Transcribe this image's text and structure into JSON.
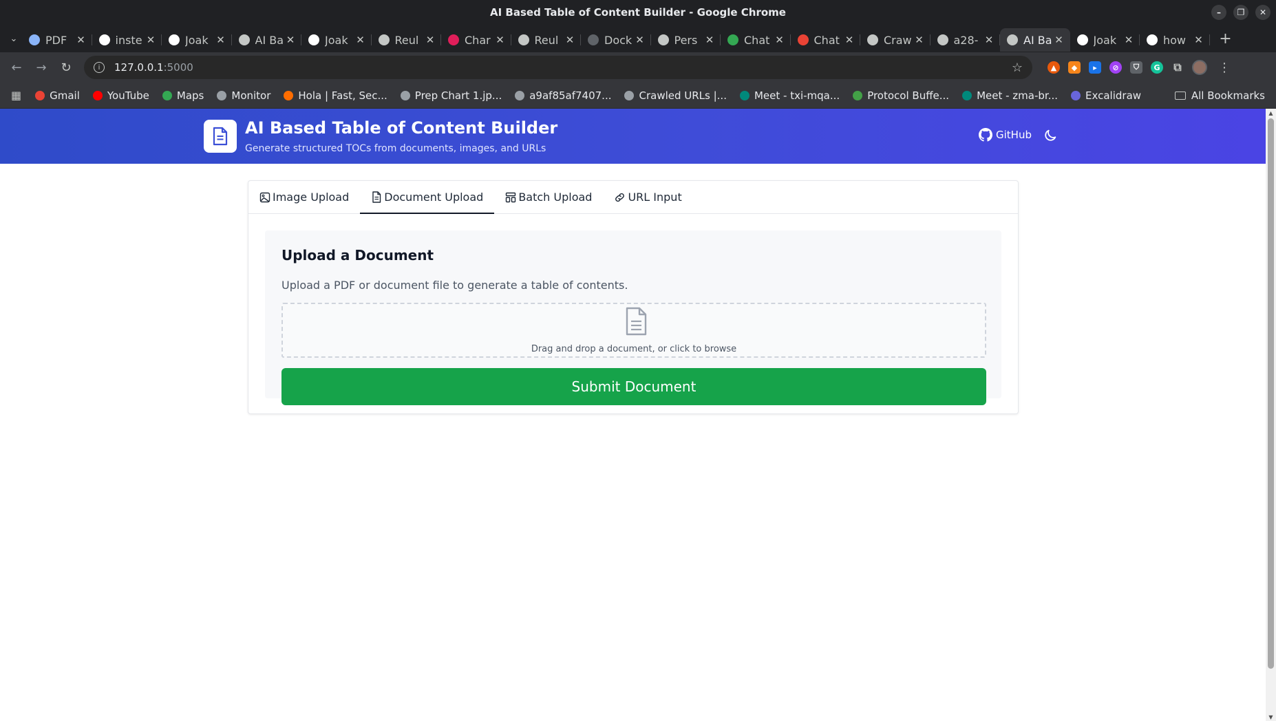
{
  "window": {
    "title": "AI Based Table of Content Builder - Google Chrome"
  },
  "tabs": [
    {
      "title": "PDF",
      "icon": "gear-icon",
      "color": "#8ab4f8"
    },
    {
      "title": "inste",
      "icon": "google-icon",
      "color": "#ffffff"
    },
    {
      "title": "Joak",
      "icon": "github-icon",
      "color": "#ffffff"
    },
    {
      "title": "AI Ba",
      "icon": "globe-icon",
      "color": "#c4c7c5"
    },
    {
      "title": "Joak",
      "icon": "github-icon",
      "color": "#ffffff"
    },
    {
      "title": "Reul",
      "icon": "globe-icon",
      "color": "#c4c7c5"
    },
    {
      "title": "Char",
      "icon": "slack-icon",
      "color": "#e01e5a"
    },
    {
      "title": "Reul",
      "icon": "globe-icon",
      "color": "#c4c7c5"
    },
    {
      "title": "Dock",
      "icon": "docker-icon",
      "color": "#5f6368"
    },
    {
      "title": "Pers",
      "icon": "globe-icon",
      "color": "#c4c7c5"
    },
    {
      "title": "Chat",
      "icon": "google-chat-icon",
      "color": "#34a853"
    },
    {
      "title": "Chat",
      "icon": "google-chat-icon",
      "color": "#ea4335"
    },
    {
      "title": "Craw",
      "icon": "globe-icon",
      "color": "#c4c7c5"
    },
    {
      "title": "a28-",
      "icon": "globe-icon",
      "color": "#c4c7c5"
    },
    {
      "title": "AI Ba",
      "icon": "globe-icon",
      "color": "#c4c7c5",
      "active": true
    },
    {
      "title": "Joak",
      "icon": "github-icon",
      "color": "#ffffff"
    },
    {
      "title": "how",
      "icon": "google-icon",
      "color": "#ffffff"
    }
  ],
  "address": {
    "host": "127.0.0.1",
    "port": ":5000"
  },
  "bookmarks": [
    {
      "label": "Gmail",
      "color": "#ea4335"
    },
    {
      "label": "YouTube",
      "color": "#ff0000"
    },
    {
      "label": "Maps",
      "color": "#34a853"
    },
    {
      "label": "Monitor",
      "color": "#9aa0a6"
    },
    {
      "label": "Hola | Fast, Sec...",
      "color": "#ff6d00"
    },
    {
      "label": "Prep Chart 1.jp...",
      "color": "#9aa0a6"
    },
    {
      "label": "a9af85af7407...",
      "color": "#9aa0a6"
    },
    {
      "label": "Crawled URLs |...",
      "color": "#9aa0a6"
    },
    {
      "label": "Meet - txi-mqa...",
      "color": "#00897b"
    },
    {
      "label": "Protocol Buffe...",
      "color": "#43a047"
    },
    {
      "label": "Meet - zma-br...",
      "color": "#00897b"
    },
    {
      "label": "Excalidraw",
      "color": "#6965db"
    }
  ],
  "all_bookmarks_label": "All Bookmarks",
  "app": {
    "title": "AI Based Table of Content Builder",
    "subtitle": "Generate structured TOCs from documents, images, and URLs",
    "github_label": "GitHub",
    "header_gradient": [
      "#2f4bc9",
      "#4a44e4"
    ]
  },
  "page_tabs": [
    {
      "label": "Image Upload",
      "icon": "image-icon"
    },
    {
      "label": "Document Upload",
      "icon": "document-icon",
      "active": true
    },
    {
      "label": "Batch Upload",
      "icon": "batch-icon"
    },
    {
      "label": "URL Input",
      "icon": "link-icon"
    }
  ],
  "panel": {
    "title": "Upload a Document",
    "description": "Upload a PDF or document file to generate a table of contents.",
    "dropzone_text": "Drag and drop a document, or click to browse",
    "submit_label": "Submit Document",
    "submit_color": "#16a34a"
  }
}
